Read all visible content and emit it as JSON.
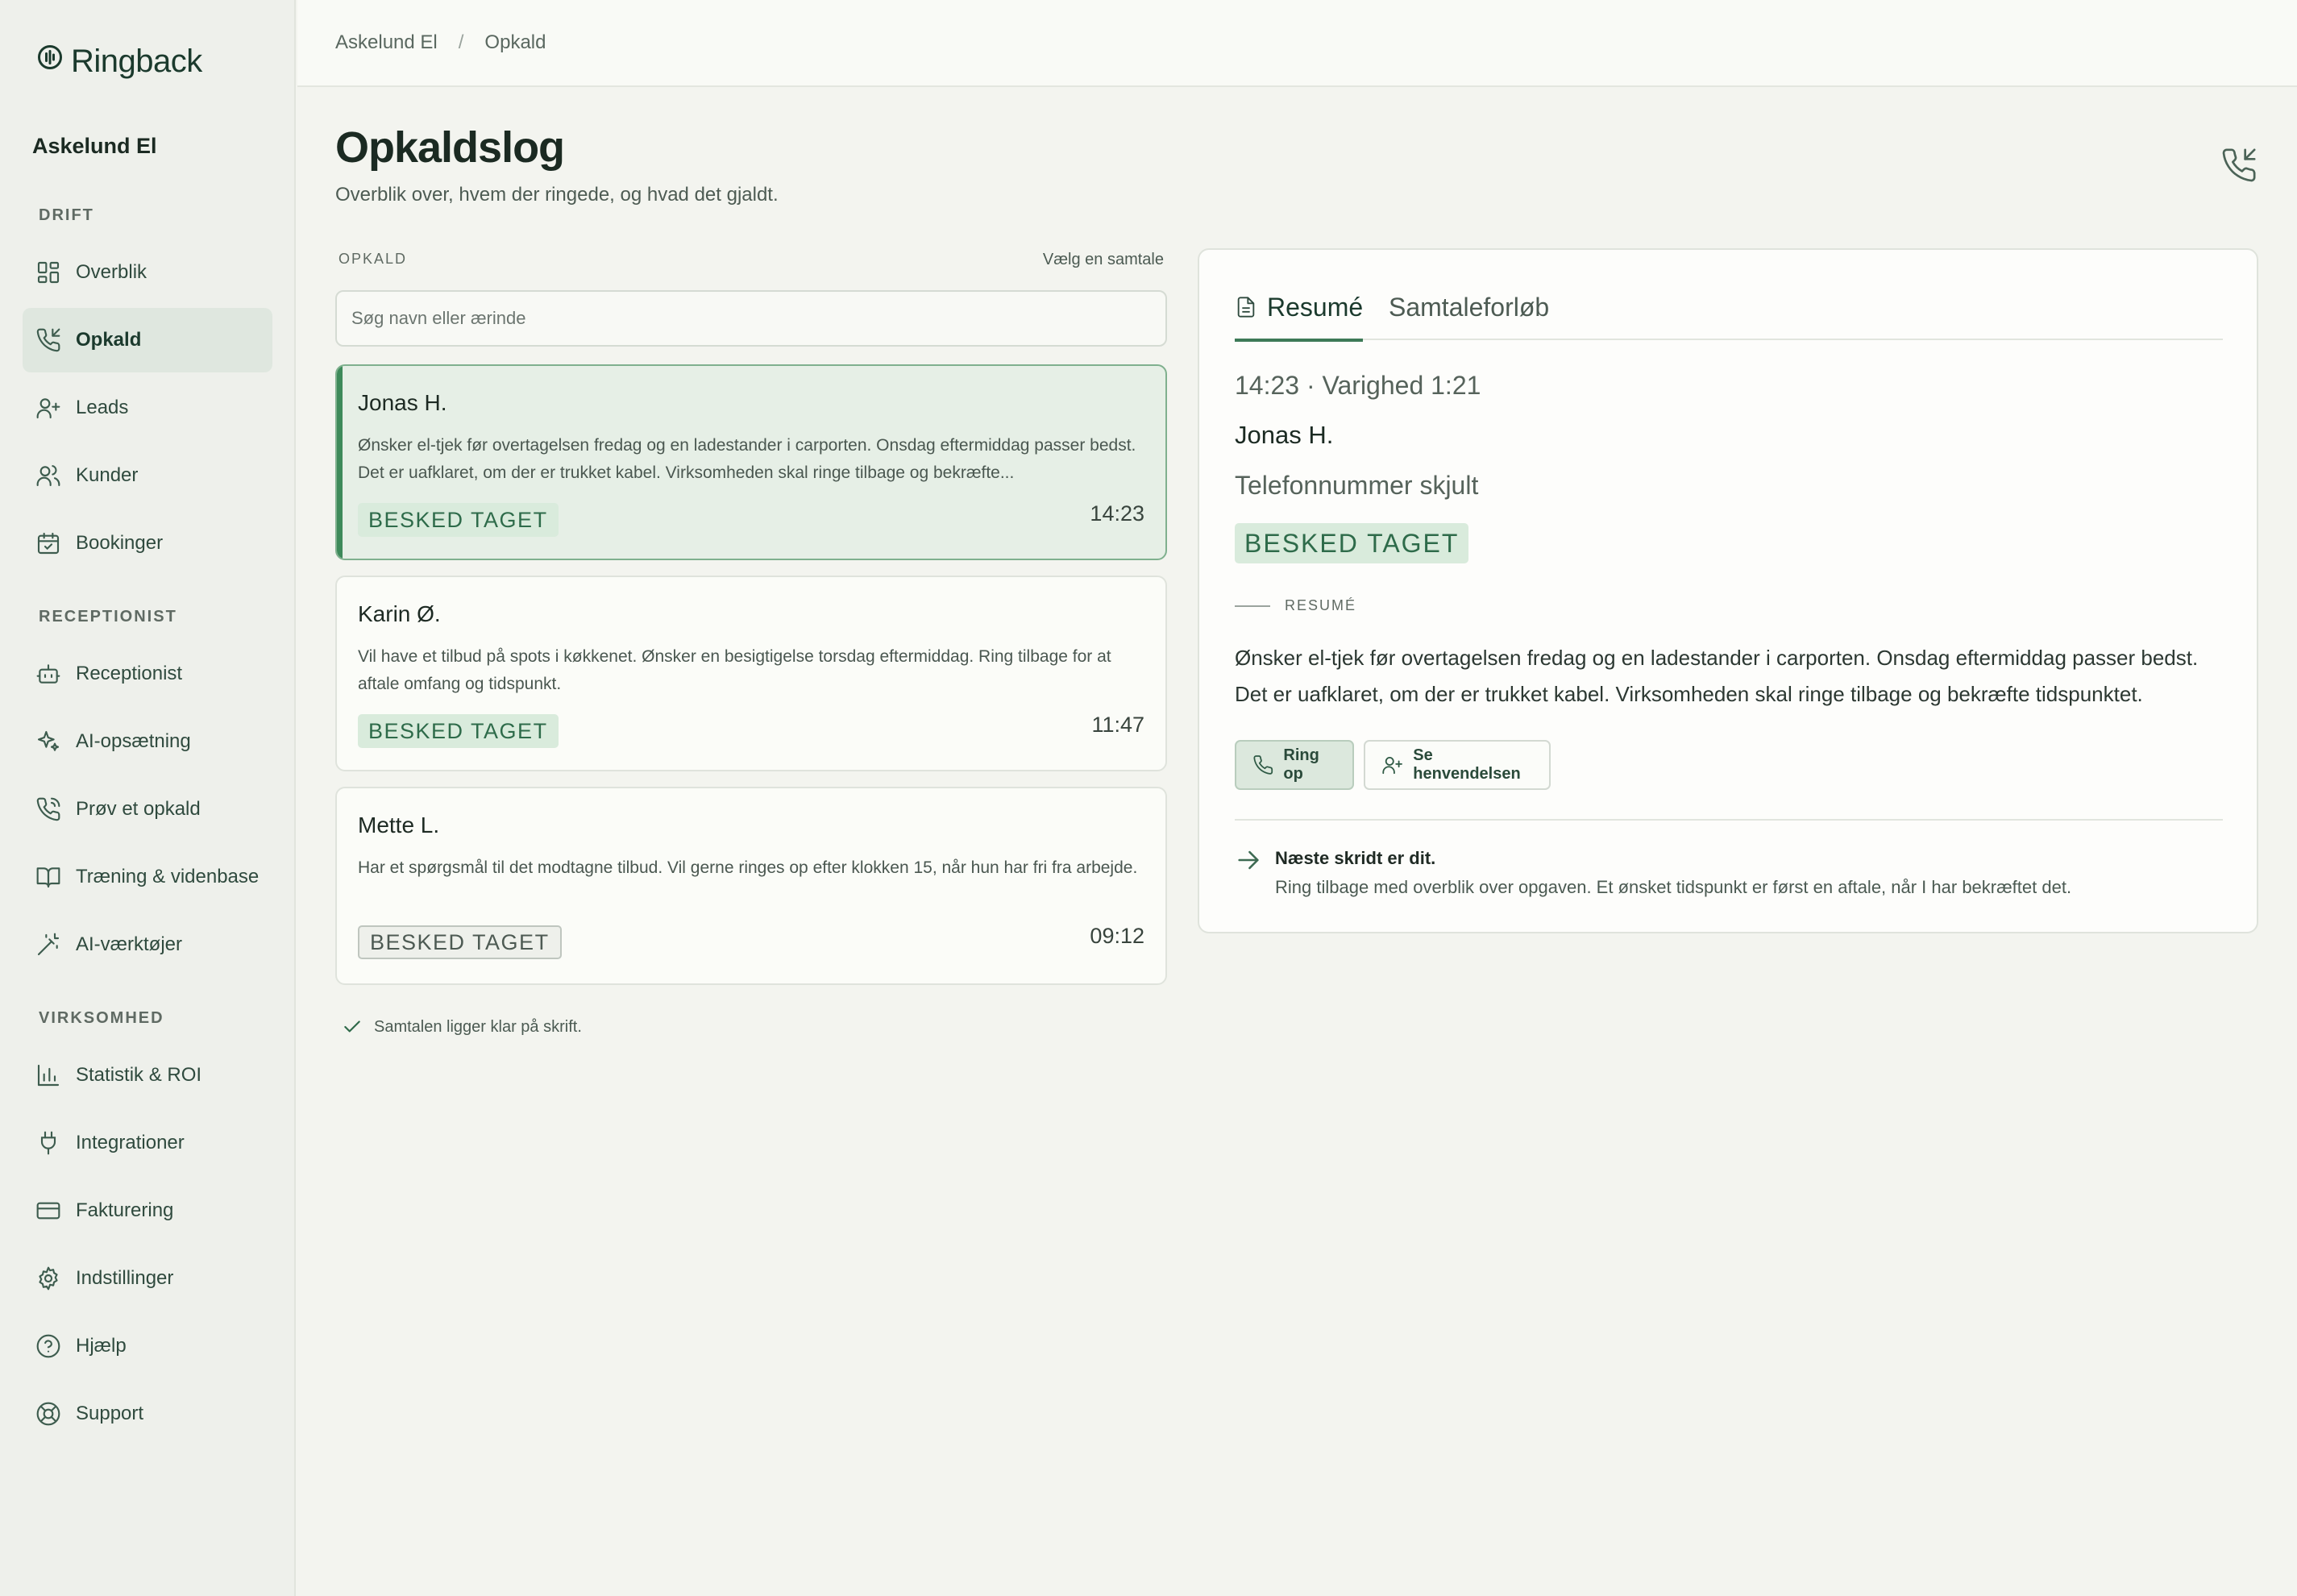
{
  "app": {
    "name": "Ringback"
  },
  "sidebar": {
    "org": "Askelund El",
    "sections": [
      {
        "label": "DRIFT",
        "items": [
          {
            "label": "Overblik",
            "icon": "grid-icon"
          },
          {
            "label": "Opkald",
            "icon": "phone-incoming-icon",
            "active": true
          },
          {
            "label": "Leads",
            "icon": "user-plus-icon"
          },
          {
            "label": "Kunder",
            "icon": "users-icon"
          },
          {
            "label": "Bookinger",
            "icon": "calendar-check-icon"
          }
        ]
      },
      {
        "label": "RECEPTIONIST",
        "items": [
          {
            "label": "Receptionist",
            "icon": "bot-icon"
          },
          {
            "label": "AI-opsætning",
            "icon": "sparkles-icon"
          },
          {
            "label": "Prøv et opkald",
            "icon": "phone-call-icon"
          },
          {
            "label": "Træning & videnbase",
            "icon": "book-icon"
          },
          {
            "label": "AI-værktøjer",
            "icon": "wand-icon"
          }
        ]
      },
      {
        "label": "VIRKSOMHED",
        "items": [
          {
            "label": "Statistik & ROI",
            "icon": "bar-chart-icon"
          },
          {
            "label": "Integrationer",
            "icon": "plug-icon"
          },
          {
            "label": "Fakturering",
            "icon": "credit-card-icon"
          },
          {
            "label": "Indstillinger",
            "icon": "gear-icon"
          },
          {
            "label": "Hjælp",
            "icon": "help-circle-icon"
          },
          {
            "label": "Support",
            "icon": "life-buoy-icon"
          }
        ]
      }
    ]
  },
  "breadcrumb": [
    "Askelund El",
    "Opkald"
  ],
  "page": {
    "title": "Opkaldslog",
    "subtitle": "Overblik over, hvem der ringede, og hvad det gjaldt."
  },
  "list": {
    "label": "OPKALD",
    "hint": "Vælg en samtale",
    "search_placeholder": "Søg navn eller ærinde",
    "calls": [
      {
        "name": "Jonas H.",
        "text": "Ønsker el-tjek før overtagelsen fredag og en ladestander i carporten. Onsdag eftermiddag passer bedst. Det er uafklaret, om der er trukket kabel. Virksomheden skal ringe tilbage og bekræfte...",
        "status": "BESKED TAGET",
        "time": "14:23",
        "selected": true
      },
      {
        "name": "Karin Ø.",
        "text": "Vil have et tilbud på spots i køkkenet. Ønsker en besigtigelse torsdag eftermiddag. Ring tilbage for at aftale omfang og tidspunkt.",
        "status": "BESKED TAGET",
        "time": "11:47",
        "selected": false
      },
      {
        "name": "Mette L.",
        "text": "Har et spørgsmål til det modtagne tilbud. Vil gerne ringes op efter klokken 15, når hun har fri fra arbejde.",
        "status": "BESKED TAGET",
        "time": "09:12",
        "selected": false
      }
    ],
    "ready_note": "Samtalen ligger klar på skrift."
  },
  "detail": {
    "tabs": [
      "Resumé",
      "Samtaleforløb"
    ],
    "meta": "14:23 · Varighed 1:21",
    "name": "Jonas H.",
    "phone": "Telefonnummer skjult",
    "status": "BESKED TAGET",
    "section_label": "RESUMÉ",
    "summary": "Ønsker el-tjek før overtagelsen fredag og en ladestander i carporten. Onsdag eftermiddag passer bedst. Det er uafklaret, om der er trukket kabel. Virksomheden skal ringe tilbage og bekræfte tidspunktet.",
    "buttons": {
      "call": "Ring op",
      "view": "Se henvendelsen"
    },
    "next_title": "Næste skridt er dit.",
    "next_text": "Ring tilbage med overblik over opgaven. Et ønsket tidspunkt er først en aftale, når I har bekræftet det."
  },
  "colors": {
    "accent": "#3d7a57",
    "badge_bg": "#d9ebdc",
    "badge_text": "#2e6b4a",
    "selected_bg": "#e6efe6"
  }
}
